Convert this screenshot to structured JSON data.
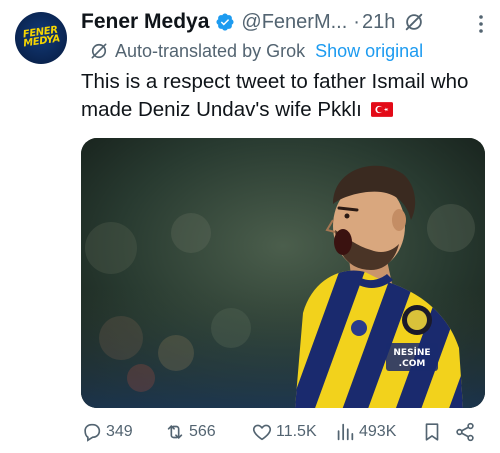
{
  "author": {
    "name": "Fener Medya",
    "handle": "@FenerM...",
    "separator": "·",
    "time": "21h",
    "avatar_text": [
      "FENER",
      "MEDYA"
    ]
  },
  "translation": {
    "label": "Auto-translated by Grok",
    "show_original": "Show original"
  },
  "tweet": {
    "text": "This is a respect tweet to father Ismail who made Deniz Undav's wife Pkklı"
  },
  "media": {
    "jersey_text_1": "NESİNE",
    "jersey_text_2": ".COM"
  },
  "actions": {
    "replies": "349",
    "reposts": "566",
    "likes": "11.5K",
    "views": "493K"
  },
  "colors": {
    "text_primary": "#0f1419",
    "text_secondary": "#536471",
    "link": "#1d9bf0",
    "verified": "#1d9bf0",
    "flag_red": "#e30a17"
  }
}
